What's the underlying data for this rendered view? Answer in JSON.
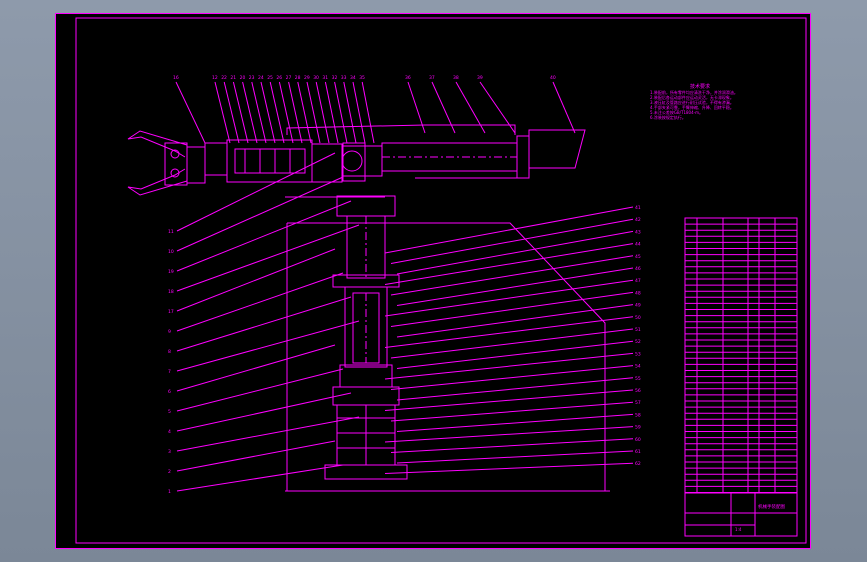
{
  "colors": {
    "desktop": "#8e9aab",
    "viewport_background": "#000000",
    "drawing_lines": "#ff00ff"
  },
  "drawing": {
    "technical_notes": {
      "title": "技术要求",
      "lines": [
        "1.装配前，所有零件均应清洗干净，并涂润滑油。",
        "2.装配后各运动部件应运动灵活，无卡滞现象。",
        "3.液压缸及管路应进行耐压试验，不得有渗漏。",
        "4.手部夹紧可靠，手臂伸缩、升降、回转平稳。",
        "5.未注公差按GB/T1804-m。",
        "6.涂装按规定执行。"
      ]
    },
    "callouts_top": [
      "16",
      "12",
      "22",
      "21",
      "20",
      "23",
      "24",
      "25",
      "26",
      "27",
      "28",
      "29",
      "30",
      "31",
      "32",
      "33",
      "34",
      "35",
      "36",
      "37",
      "38",
      "39",
      "40"
    ],
    "callouts_left": [
      "11",
      "10",
      "19",
      "18",
      "17",
      "9",
      "8",
      "7",
      "6",
      "5",
      "4",
      "3",
      "2",
      "1"
    ],
    "callouts_right": [
      "41",
      "42",
      "43",
      "44",
      "45",
      "46",
      "47",
      "48",
      "49",
      "50",
      "51",
      "52",
      "53",
      "54",
      "55",
      "56",
      "57",
      "58",
      "59",
      "60",
      "61",
      "62"
    ],
    "title_block": {
      "drawing_name": "机械手装配图",
      "scale": "1:4"
    }
  }
}
